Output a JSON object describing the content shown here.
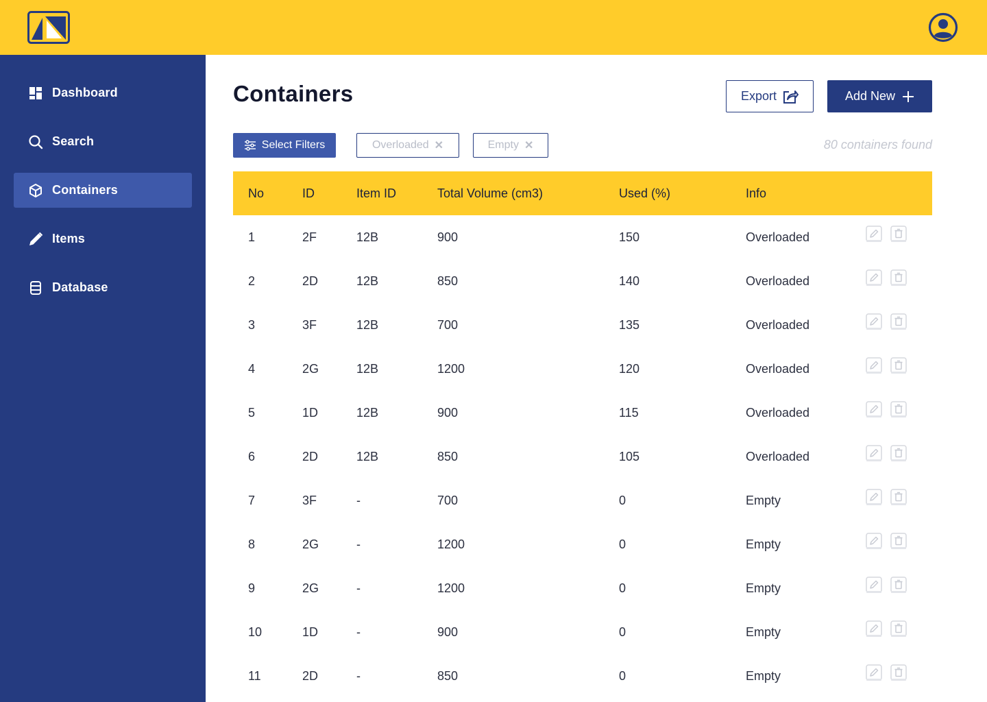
{
  "header": {
    "logo_icon": "brand-logo",
    "profile_icon": "user-circle-icon",
    "brand_color": "#ffcc2a",
    "accent_color": "#253b80"
  },
  "sidebar": {
    "items": [
      {
        "label": "Dashboard",
        "icon": "dashboard-icon"
      },
      {
        "label": "Search",
        "icon": "search-icon"
      },
      {
        "label": "Containers",
        "icon": "cube-icon",
        "active": true
      },
      {
        "label": "Items",
        "icon": "pencil-icon"
      },
      {
        "label": "Database",
        "icon": "database-icon"
      }
    ]
  },
  "main": {
    "title": "Containers",
    "export_label": "Export",
    "add_new_label": "Add New",
    "select_filters_label": "Select Filters",
    "filter_chips": [
      "Overloaded",
      "Empty"
    ],
    "results_count": "80 containers found"
  },
  "table": {
    "columns": [
      "No",
      "ID",
      "Item ID",
      "Total Volume (cm3)",
      "Used (%)",
      "Info"
    ],
    "rows": [
      [
        "1",
        "2F",
        "12B",
        "900",
        "150",
        "Overloaded"
      ],
      [
        "2",
        "2D",
        "12B",
        "850",
        "140",
        "Overloaded"
      ],
      [
        "3",
        "3F",
        "12B",
        "700",
        "135",
        "Overloaded"
      ],
      [
        "4",
        "2G",
        "12B",
        "1200",
        "120",
        "Overloaded"
      ],
      [
        "5",
        "1D",
        "12B",
        "900",
        "115",
        "Overloaded"
      ],
      [
        "6",
        "2D",
        "12B",
        "850",
        "105",
        "Overloaded"
      ],
      [
        "7",
        "3F",
        "-",
        "700",
        "0",
        "Empty"
      ],
      [
        "8",
        "2G",
        "-",
        "1200",
        "0",
        "Empty"
      ],
      [
        "9",
        "2G",
        "-",
        "1200",
        "0",
        "Empty"
      ],
      [
        "10",
        "1D",
        "-",
        "900",
        "0",
        "Empty"
      ],
      [
        "11",
        "2D",
        "-",
        "850",
        "0",
        "Empty"
      ]
    ],
    "row_actions": [
      "edit-icon",
      "trash-icon"
    ]
  }
}
